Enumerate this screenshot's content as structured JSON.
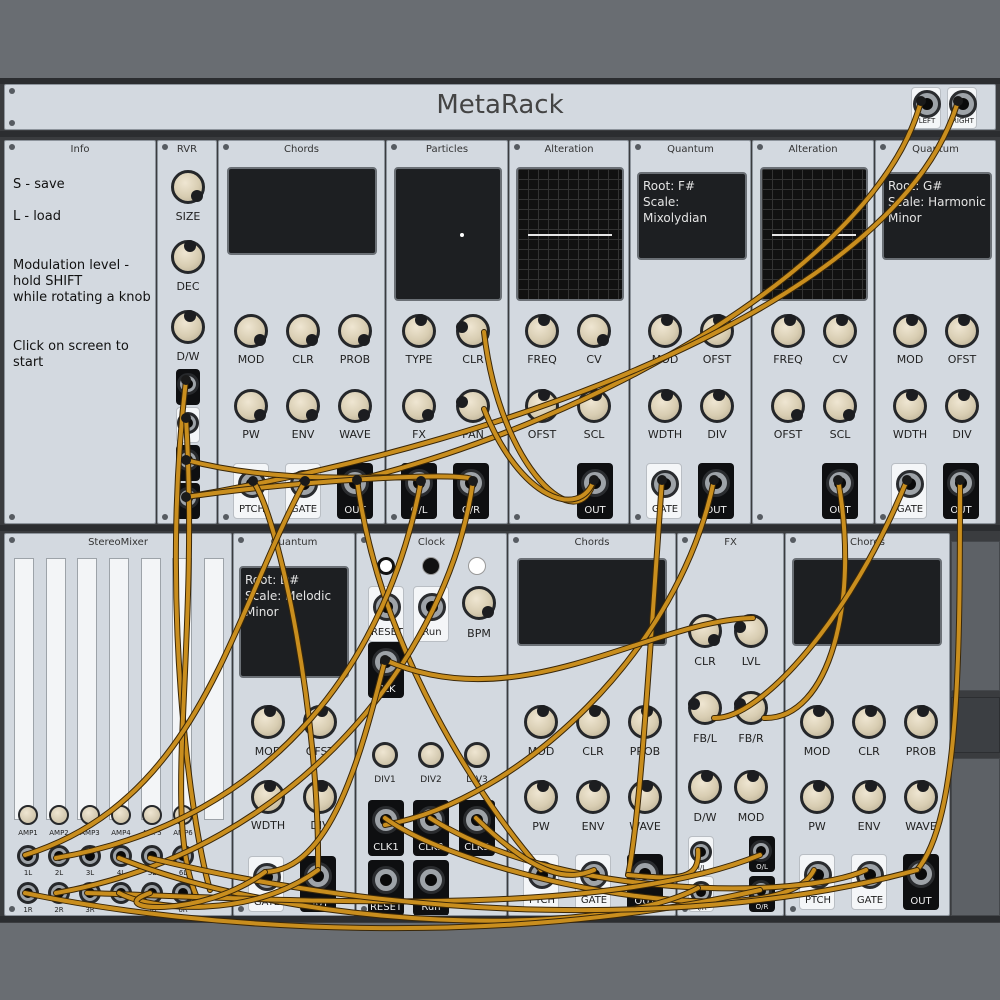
{
  "header": {
    "title": "MetaRack",
    "jacks": [
      "LEFT",
      "RIGHT"
    ]
  },
  "info": {
    "title": "Info",
    "save": "S - save",
    "load": "L - load",
    "modulation": "Modulation level -\nhold SHIFT\nwhile rotating a knob",
    "start": "Click on screen to start"
  },
  "rvr": {
    "title": "RVR",
    "knobs": [
      "SIZE",
      "DEC",
      "D/W"
    ]
  },
  "chords1": {
    "title": "Chords",
    "knobs": [
      "MOD",
      "CLR",
      "PROB",
      "PW",
      "ENV",
      "WAVE"
    ],
    "jacks": [
      "PTCH",
      "GATE",
      "OUT"
    ]
  },
  "particles": {
    "title": "Particles",
    "knobs": [
      "TYPE",
      "CLR",
      "FX",
      "PAN"
    ],
    "jacks": [
      "O/L",
      "O/R"
    ]
  },
  "alteration1": {
    "title": "Alteration",
    "knobs": [
      "FREQ",
      "CV",
      "OFST",
      "SCL"
    ],
    "jacks": [
      "OUT"
    ]
  },
  "quantum1": {
    "title": "Quantum",
    "screen": "Root: F#\nScale: Mixolydian",
    "knobs": [
      "MOD",
      "OFST",
      "WDTH",
      "DIV"
    ],
    "jacks": [
      "GATE",
      "OUT"
    ]
  },
  "alteration2": {
    "title": "Alteration",
    "knobs": [
      "FREQ",
      "CV",
      "OFST",
      "SCL"
    ],
    "jacks": [
      "OUT"
    ]
  },
  "quantum2": {
    "title": "Quantum",
    "screen": "Root: G#\nScale: Harmonic\nMinor",
    "knobs": [
      "MOD",
      "OFST",
      "WDTH",
      "DIV"
    ],
    "jacks": [
      "GATE",
      "OUT"
    ]
  },
  "stereomixer": {
    "title": "StereoMixer",
    "amps": [
      "AMP1",
      "AMP2",
      "AMP3",
      "AMP4",
      "AMP5",
      "AMP6"
    ],
    "left": [
      "1L",
      "2L",
      "3L",
      "4L",
      "5L",
      "6L"
    ],
    "right": [
      "1R",
      "2R",
      "3R",
      "4R",
      "5R",
      "6R"
    ]
  },
  "quantum3": {
    "title": "Quantum",
    "screen": "Root: D#\nScale: Melodic\nMinor",
    "knobs": [
      "MOD",
      "OFST",
      "WDTH",
      "DIV"
    ],
    "jacks": [
      "GATE",
      "OUT"
    ]
  },
  "clock": {
    "title": "Clock",
    "jacks_top": [
      "RESET",
      "Run"
    ],
    "bpm": "BPM",
    "clk": "CLK",
    "divs": [
      "DIV1",
      "DIV2",
      "DIV3"
    ],
    "div_jacks": [
      "CLK1",
      "CLK2",
      "CLK3"
    ],
    "bottom_jacks": [
      "RESET",
      "Run"
    ]
  },
  "chords2": {
    "title": "Chords",
    "knobs": [
      "MOD",
      "CLR",
      "PROB",
      "PW",
      "ENV",
      "WAVE"
    ],
    "jacks": [
      "PTCH",
      "GATE",
      "OUT"
    ]
  },
  "fx": {
    "title": "FX",
    "knobs": [
      "CLR",
      "LVL",
      "FB/L",
      "FB/R",
      "D/W",
      "MOD"
    ],
    "jacks": [
      "I/L",
      "I/R",
      "O/L",
      "O/R"
    ]
  },
  "chords3": {
    "title": "Chords",
    "knobs": [
      "MOD",
      "CLR",
      "PROB",
      "PW",
      "ENV",
      "WAVE"
    ],
    "jacks": [
      "PTCH",
      "GATE",
      "OUT"
    ]
  },
  "colors": {
    "panel": "#d3d9e0",
    "cable": "#c98e1e",
    "screen": "#1d1f22",
    "knob": "#d8cdb2"
  }
}
